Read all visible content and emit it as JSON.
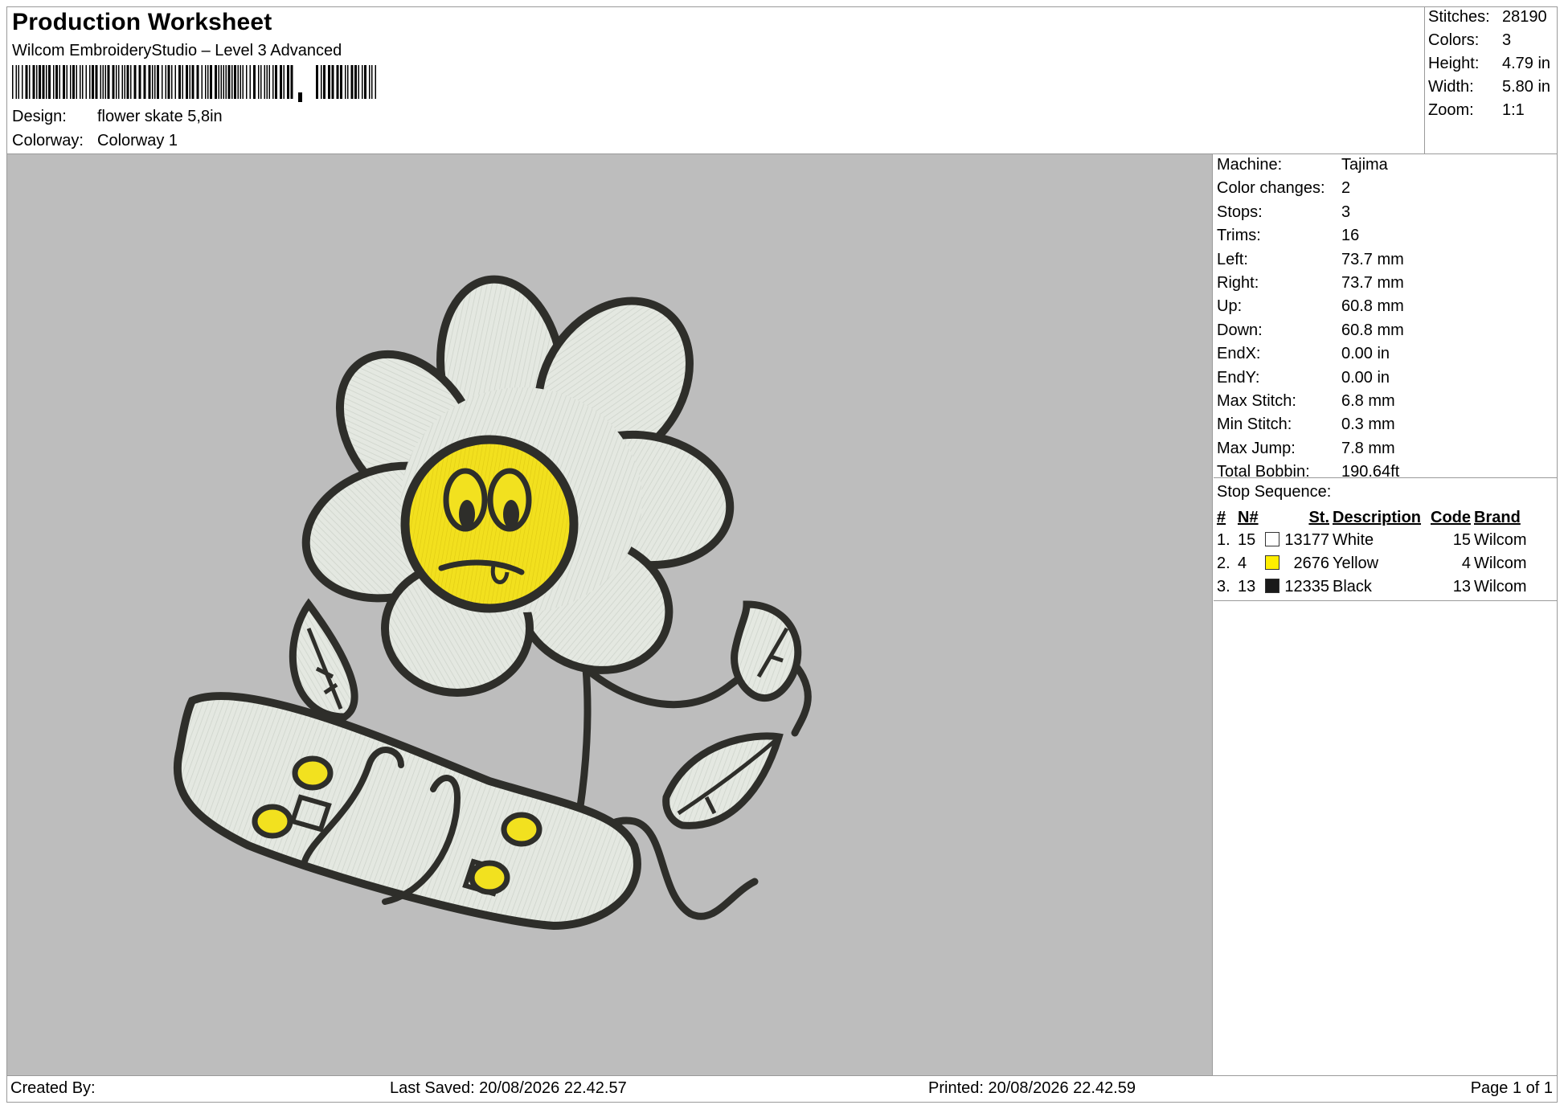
{
  "header": {
    "title": "Production Worksheet",
    "software": "Wilcom EmbroideryStudio – Level 3 Advanced",
    "design_label": "Design:",
    "design_value": "flower skate 5,8in",
    "colorway_label": "Colorway:",
    "colorway_value": "Colorway 1"
  },
  "stats": {
    "stitches_label": "Stitches:",
    "stitches": "28190",
    "colors_label": "Colors:",
    "colors": "3",
    "height_label": "Height:",
    "height": "4.79 in",
    "width_label": "Width:",
    "width": "5.80 in",
    "zoom_label": "Zoom:",
    "zoom": "1:1"
  },
  "machine_info": [
    {
      "label": "Machine:",
      "value": "Tajima"
    },
    {
      "label": "Color changes:",
      "value": "2"
    },
    {
      "label": "Stops:",
      "value": "3"
    },
    {
      "label": "Trims:",
      "value": "16"
    },
    {
      "label": "Left:",
      "value": "73.7 mm"
    },
    {
      "label": "Right:",
      "value": "73.7 mm"
    },
    {
      "label": "Up:",
      "value": "60.8 mm"
    },
    {
      "label": "Down:",
      "value": "60.8 mm"
    },
    {
      "label": "EndX:",
      "value": "0.00 in"
    },
    {
      "label": "EndY:",
      "value": "0.00 in"
    },
    {
      "label": "Max Stitch:",
      "value": "6.8 mm"
    },
    {
      "label": "Min Stitch:",
      "value": "0.3 mm"
    },
    {
      "label": "Max Jump:",
      "value": "7.8 mm"
    },
    {
      "label": "Total Bobbin:",
      "value": "190.64ft"
    }
  ],
  "stop_sequence": {
    "title": "Stop Sequence:",
    "headers": {
      "num": "#",
      "n": "N#",
      "st": "St.",
      "description": "Description",
      "code": "Code",
      "brand": "Brand"
    },
    "rows": [
      {
        "num": "1.",
        "n": "15",
        "color": "#ffffff",
        "st": "13177",
        "description": "White",
        "code": "15",
        "brand": "Wilcom"
      },
      {
        "num": "2.",
        "n": "4",
        "color": "#ffee00",
        "st": "2676",
        "description": "Yellow",
        "code": "4",
        "brand": "Wilcom"
      },
      {
        "num": "3.",
        "n": "13",
        "color": "#1a1a1a",
        "st": "12335",
        "description": "Black",
        "code": "13",
        "brand": "Wilcom"
      }
    ]
  },
  "footer": {
    "created_by": "Created By:",
    "last_saved": "Last Saved: 20/08/2026 22.42.57",
    "printed": "Printed: 20/08/2026 22.42.59",
    "page": "Page 1 of 1"
  },
  "design_colors": {
    "canvas": "#bdbdbd",
    "thread_white": "#e6eae3",
    "thread_yellow": "#f2e11f",
    "thread_black": "#2e2e2a"
  }
}
